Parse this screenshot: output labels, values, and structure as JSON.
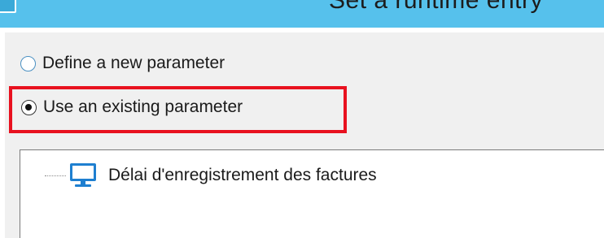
{
  "window": {
    "title": "Set a runtime entry"
  },
  "options": {
    "new_parameter": {
      "label": "Define a new parameter",
      "selected": false
    },
    "existing_parameter": {
      "label": "Use an existing parameter",
      "selected": true
    }
  },
  "tree": {
    "items": [
      {
        "label": "Délai d'enregistrement des factures",
        "icon": "monitor-icon"
      }
    ]
  },
  "colors": {
    "titlebar": "#56c1ec",
    "highlight": "#e8111f",
    "radio_border": "#4a90c2"
  }
}
